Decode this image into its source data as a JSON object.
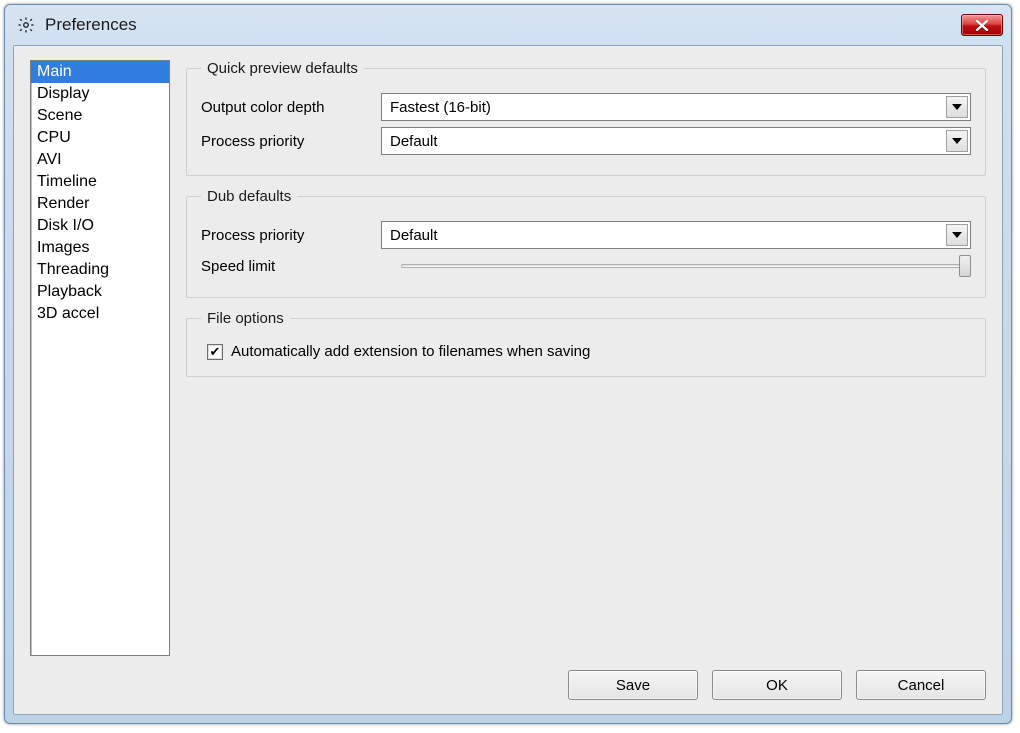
{
  "window": {
    "title": "Preferences"
  },
  "sidebar": {
    "items": [
      "Main",
      "Display",
      "Scene",
      "CPU",
      "AVI",
      "Timeline",
      "Render",
      "Disk I/O",
      "Images",
      "Threading",
      "Playback",
      "3D accel"
    ],
    "selected_index": 0
  },
  "panel": {
    "quick_preview": {
      "legend": "Quick preview defaults",
      "color_depth_label": "Output color depth",
      "color_depth_value": "Fastest (16-bit)",
      "priority_label": "Process priority",
      "priority_value": "Default"
    },
    "dub": {
      "legend": "Dub defaults",
      "priority_label": "Process priority",
      "priority_value": "Default",
      "speed_label": "Speed limit"
    },
    "file": {
      "legend": "File options",
      "auto_ext_checked": true,
      "auto_ext_label": "Automatically add extension to filenames when saving"
    }
  },
  "buttons": {
    "save": "Save",
    "ok": "OK",
    "cancel": "Cancel"
  }
}
